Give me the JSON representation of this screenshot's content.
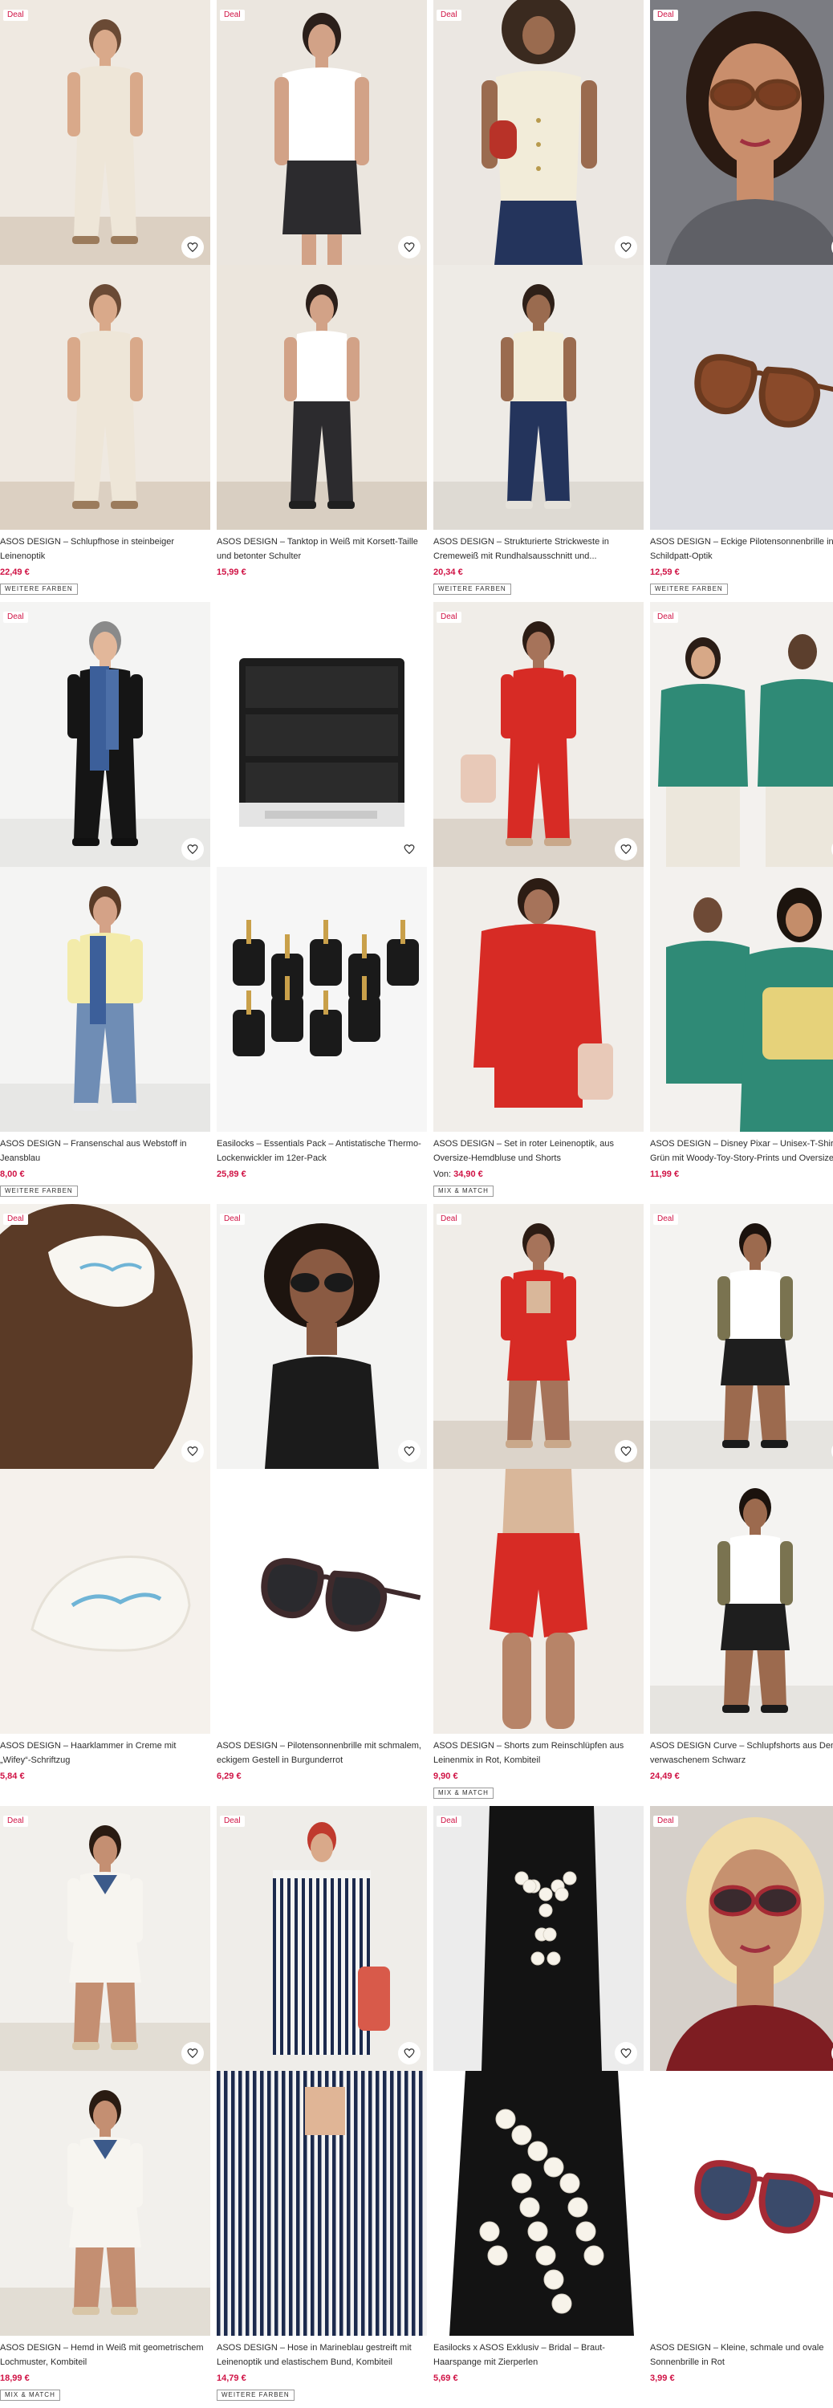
{
  "ui": {
    "heart_icon": "heart-outline",
    "accent": "#d01345"
  },
  "products": [
    {
      "deal": "Deal",
      "title": "ASOS DESIGN – Schlupfhose in steinbeiger Leinenoptik",
      "price_prefix": "",
      "price": "22,49 €",
      "badge": "WEITERE FARBEN",
      "scene": "beige-set"
    },
    {
      "deal": "Deal",
      "title": "ASOS DESIGN – Tanktop in Weiß mit Korsett-Taille und betonter Schulter",
      "price_prefix": "",
      "price": "15,99 €",
      "badge": "",
      "scene": "white-top"
    },
    {
      "deal": "Deal",
      "title": "ASOS DESIGN – Strukturierte Strickweste in Cremeweiß mit Rundhalsausschnitt und...",
      "price_prefix": "",
      "price": "20,34 €",
      "badge": "WEITERE FARBEN",
      "scene": "cream-vest"
    },
    {
      "deal": "Deal",
      "title": "ASOS DESIGN – Eckige Pilotensonnenbrille in Schildpatt-Optik",
      "price_prefix": "",
      "price": "12,59 €",
      "badge": "WEITERE FARBEN",
      "scene": "tortoise-glasses"
    },
    {
      "deal": "Deal",
      "title": "ASOS DESIGN – Fransenschal aus Webstoff in Jeansblau",
      "price_prefix": "",
      "price": "8,00 €",
      "badge": "WEITERE FARBEN",
      "scene": "blue-scarf"
    },
    {
      "deal": "",
      "title": "Easilocks – Essentials Pack – Antistatische Thermo-Lockenwickler im 12er-Pack",
      "price_prefix": "",
      "price": "25,89 €",
      "badge": "",
      "scene": "rollers"
    },
    {
      "deal": "Deal",
      "title": "ASOS DESIGN – Set in roter Leinenoptik, aus Oversize-Hemdbluse und Shorts",
      "price_prefix": "Von: ",
      "price": "34,90 €",
      "badge": "MIX & MATCH",
      "scene": "red-shirt"
    },
    {
      "deal": "Deal",
      "title": "ASOS DESIGN – Disney Pixar – Unisex-T-Shirt in Grün mit Woody-Toy-Story-Prints und Oversize-...",
      "price_prefix": "",
      "price": "11,99 €",
      "badge": "",
      "scene": "green-tee"
    },
    {
      "deal": "Deal",
      "title": "ASOS DESIGN – Haarklammer in Creme mit „Wifey“-Schriftzug",
      "price_prefix": "",
      "price": "5,84 €",
      "badge": "",
      "scene": "hair-clip"
    },
    {
      "deal": "Deal",
      "title": "ASOS DESIGN – Pilotensonnenbrille mit schmalem, eckigem Gestell in Burgunderrot",
      "price_prefix": "",
      "price": "6,29 €",
      "badge": "",
      "scene": "burgundy-glasses"
    },
    {
      "deal": "Deal",
      "title": "ASOS DESIGN – Shorts zum Reinschlüpfen aus Leinenmix in Rot, Kombiteil",
      "price_prefix": "",
      "price": "9,90 €",
      "badge": "MIX & MATCH",
      "scene": "red-shorts"
    },
    {
      "deal": "Deal",
      "title": "ASOS DESIGN Curve – Schlupfshorts aus Denim in verwaschenem Schwarz",
      "price_prefix": "",
      "price": "24,49 €",
      "badge": "",
      "scene": "black-shorts"
    },
    {
      "deal": "Deal",
      "title": "ASOS DESIGN – Hemd in Weiß mit geometrischem Lochmuster, Kombiteil",
      "price_prefix": "",
      "price": "18,99 €",
      "badge": "MIX & MATCH",
      "scene": "white-lace"
    },
    {
      "deal": "Deal",
      "title": "ASOS DESIGN – Hose in Marineblau gestreift mit Leinenoptik und elastischem Bund, Kombiteil",
      "price_prefix": "",
      "price": "14,79 €",
      "badge": "WEITERE FARBEN",
      "scene": "striped"
    },
    {
      "deal": "Deal",
      "title": "Easilocks x ASOS Exklusiv – Bridal – Braut-Haarspange mit Zierperlen",
      "price_prefix": "",
      "price": "5,69 €",
      "badge": "",
      "scene": "pearl-bow"
    },
    {
      "deal": "Deal",
      "title": "ASOS DESIGN – Kleine, schmale und ovale Sonnenbrille in Rot",
      "price_prefix": "",
      "price": "3,99 €",
      "badge": "",
      "scene": "red-glasses"
    }
  ]
}
